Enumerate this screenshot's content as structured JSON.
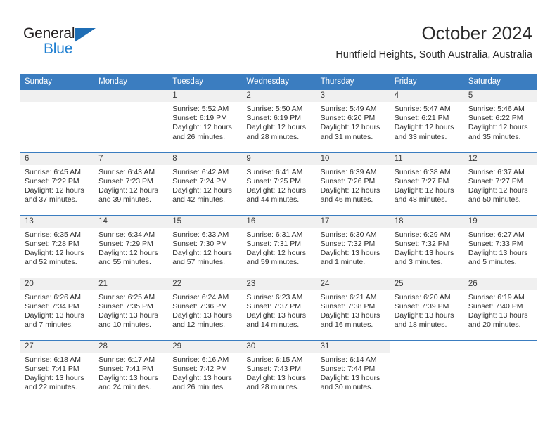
{
  "brand": {
    "name_part1": "General",
    "name_part2": "Blue",
    "accent_color": "#1f7fd1",
    "triangle_color": "#1f6eb5"
  },
  "header": {
    "title": "October 2024",
    "subtitle": "Huntfield Heights, South Australia, Australia"
  },
  "theme": {
    "header_row_bg": "#3b7dc0",
    "daynum_band_bg": "#f0f0f0",
    "grid_line": "#3b7dc0"
  },
  "weekday_headers": [
    "Sunday",
    "Monday",
    "Tuesday",
    "Wednesday",
    "Thursday",
    "Friday",
    "Saturday"
  ],
  "weeks": [
    [
      {
        "day": "",
        "blank": true
      },
      {
        "day": "",
        "blank": true
      },
      {
        "day": "1",
        "sunrise": "Sunrise: 5:52 AM",
        "sunset": "Sunset: 6:19 PM",
        "daylight": "Daylight: 12 hours and 26 minutes."
      },
      {
        "day": "2",
        "sunrise": "Sunrise: 5:50 AM",
        "sunset": "Sunset: 6:19 PM",
        "daylight": "Daylight: 12 hours and 28 minutes."
      },
      {
        "day": "3",
        "sunrise": "Sunrise: 5:49 AM",
        "sunset": "Sunset: 6:20 PM",
        "daylight": "Daylight: 12 hours and 31 minutes."
      },
      {
        "day": "4",
        "sunrise": "Sunrise: 5:47 AM",
        "sunset": "Sunset: 6:21 PM",
        "daylight": "Daylight: 12 hours and 33 minutes."
      },
      {
        "day": "5",
        "sunrise": "Sunrise: 5:46 AM",
        "sunset": "Sunset: 6:22 PM",
        "daylight": "Daylight: 12 hours and 35 minutes."
      }
    ],
    [
      {
        "day": "6",
        "sunrise": "Sunrise: 6:45 AM",
        "sunset": "Sunset: 7:22 PM",
        "daylight": "Daylight: 12 hours and 37 minutes."
      },
      {
        "day": "7",
        "sunrise": "Sunrise: 6:43 AM",
        "sunset": "Sunset: 7:23 PM",
        "daylight": "Daylight: 12 hours and 39 minutes."
      },
      {
        "day": "8",
        "sunrise": "Sunrise: 6:42 AM",
        "sunset": "Sunset: 7:24 PM",
        "daylight": "Daylight: 12 hours and 42 minutes."
      },
      {
        "day": "9",
        "sunrise": "Sunrise: 6:41 AM",
        "sunset": "Sunset: 7:25 PM",
        "daylight": "Daylight: 12 hours and 44 minutes."
      },
      {
        "day": "10",
        "sunrise": "Sunrise: 6:39 AM",
        "sunset": "Sunset: 7:26 PM",
        "daylight": "Daylight: 12 hours and 46 minutes."
      },
      {
        "day": "11",
        "sunrise": "Sunrise: 6:38 AM",
        "sunset": "Sunset: 7:27 PM",
        "daylight": "Daylight: 12 hours and 48 minutes."
      },
      {
        "day": "12",
        "sunrise": "Sunrise: 6:37 AM",
        "sunset": "Sunset: 7:27 PM",
        "daylight": "Daylight: 12 hours and 50 minutes."
      }
    ],
    [
      {
        "day": "13",
        "sunrise": "Sunrise: 6:35 AM",
        "sunset": "Sunset: 7:28 PM",
        "daylight": "Daylight: 12 hours and 52 minutes."
      },
      {
        "day": "14",
        "sunrise": "Sunrise: 6:34 AM",
        "sunset": "Sunset: 7:29 PM",
        "daylight": "Daylight: 12 hours and 55 minutes."
      },
      {
        "day": "15",
        "sunrise": "Sunrise: 6:33 AM",
        "sunset": "Sunset: 7:30 PM",
        "daylight": "Daylight: 12 hours and 57 minutes."
      },
      {
        "day": "16",
        "sunrise": "Sunrise: 6:31 AM",
        "sunset": "Sunset: 7:31 PM",
        "daylight": "Daylight: 12 hours and 59 minutes."
      },
      {
        "day": "17",
        "sunrise": "Sunrise: 6:30 AM",
        "sunset": "Sunset: 7:32 PM",
        "daylight": "Daylight: 13 hours and 1 minute."
      },
      {
        "day": "18",
        "sunrise": "Sunrise: 6:29 AM",
        "sunset": "Sunset: 7:32 PM",
        "daylight": "Daylight: 13 hours and 3 minutes."
      },
      {
        "day": "19",
        "sunrise": "Sunrise: 6:27 AM",
        "sunset": "Sunset: 7:33 PM",
        "daylight": "Daylight: 13 hours and 5 minutes."
      }
    ],
    [
      {
        "day": "20",
        "sunrise": "Sunrise: 6:26 AM",
        "sunset": "Sunset: 7:34 PM",
        "daylight": "Daylight: 13 hours and 7 minutes."
      },
      {
        "day": "21",
        "sunrise": "Sunrise: 6:25 AM",
        "sunset": "Sunset: 7:35 PM",
        "daylight": "Daylight: 13 hours and 10 minutes."
      },
      {
        "day": "22",
        "sunrise": "Sunrise: 6:24 AM",
        "sunset": "Sunset: 7:36 PM",
        "daylight": "Daylight: 13 hours and 12 minutes."
      },
      {
        "day": "23",
        "sunrise": "Sunrise: 6:23 AM",
        "sunset": "Sunset: 7:37 PM",
        "daylight": "Daylight: 13 hours and 14 minutes."
      },
      {
        "day": "24",
        "sunrise": "Sunrise: 6:21 AM",
        "sunset": "Sunset: 7:38 PM",
        "daylight": "Daylight: 13 hours and 16 minutes."
      },
      {
        "day": "25",
        "sunrise": "Sunrise: 6:20 AM",
        "sunset": "Sunset: 7:39 PM",
        "daylight": "Daylight: 13 hours and 18 minutes."
      },
      {
        "day": "26",
        "sunrise": "Sunrise: 6:19 AM",
        "sunset": "Sunset: 7:40 PM",
        "daylight": "Daylight: 13 hours and 20 minutes."
      }
    ],
    [
      {
        "day": "27",
        "sunrise": "Sunrise: 6:18 AM",
        "sunset": "Sunset: 7:41 PM",
        "daylight": "Daylight: 13 hours and 22 minutes."
      },
      {
        "day": "28",
        "sunrise": "Sunrise: 6:17 AM",
        "sunset": "Sunset: 7:41 PM",
        "daylight": "Daylight: 13 hours and 24 minutes."
      },
      {
        "day": "29",
        "sunrise": "Sunrise: 6:16 AM",
        "sunset": "Sunset: 7:42 PM",
        "daylight": "Daylight: 13 hours and 26 minutes."
      },
      {
        "day": "30",
        "sunrise": "Sunrise: 6:15 AM",
        "sunset": "Sunset: 7:43 PM",
        "daylight": "Daylight: 13 hours and 28 minutes."
      },
      {
        "day": "31",
        "sunrise": "Sunrise: 6:14 AM",
        "sunset": "Sunset: 7:44 PM",
        "daylight": "Daylight: 13 hours and 30 minutes."
      },
      {
        "day": "",
        "blank": true
      },
      {
        "day": "",
        "blank": true
      }
    ]
  ]
}
